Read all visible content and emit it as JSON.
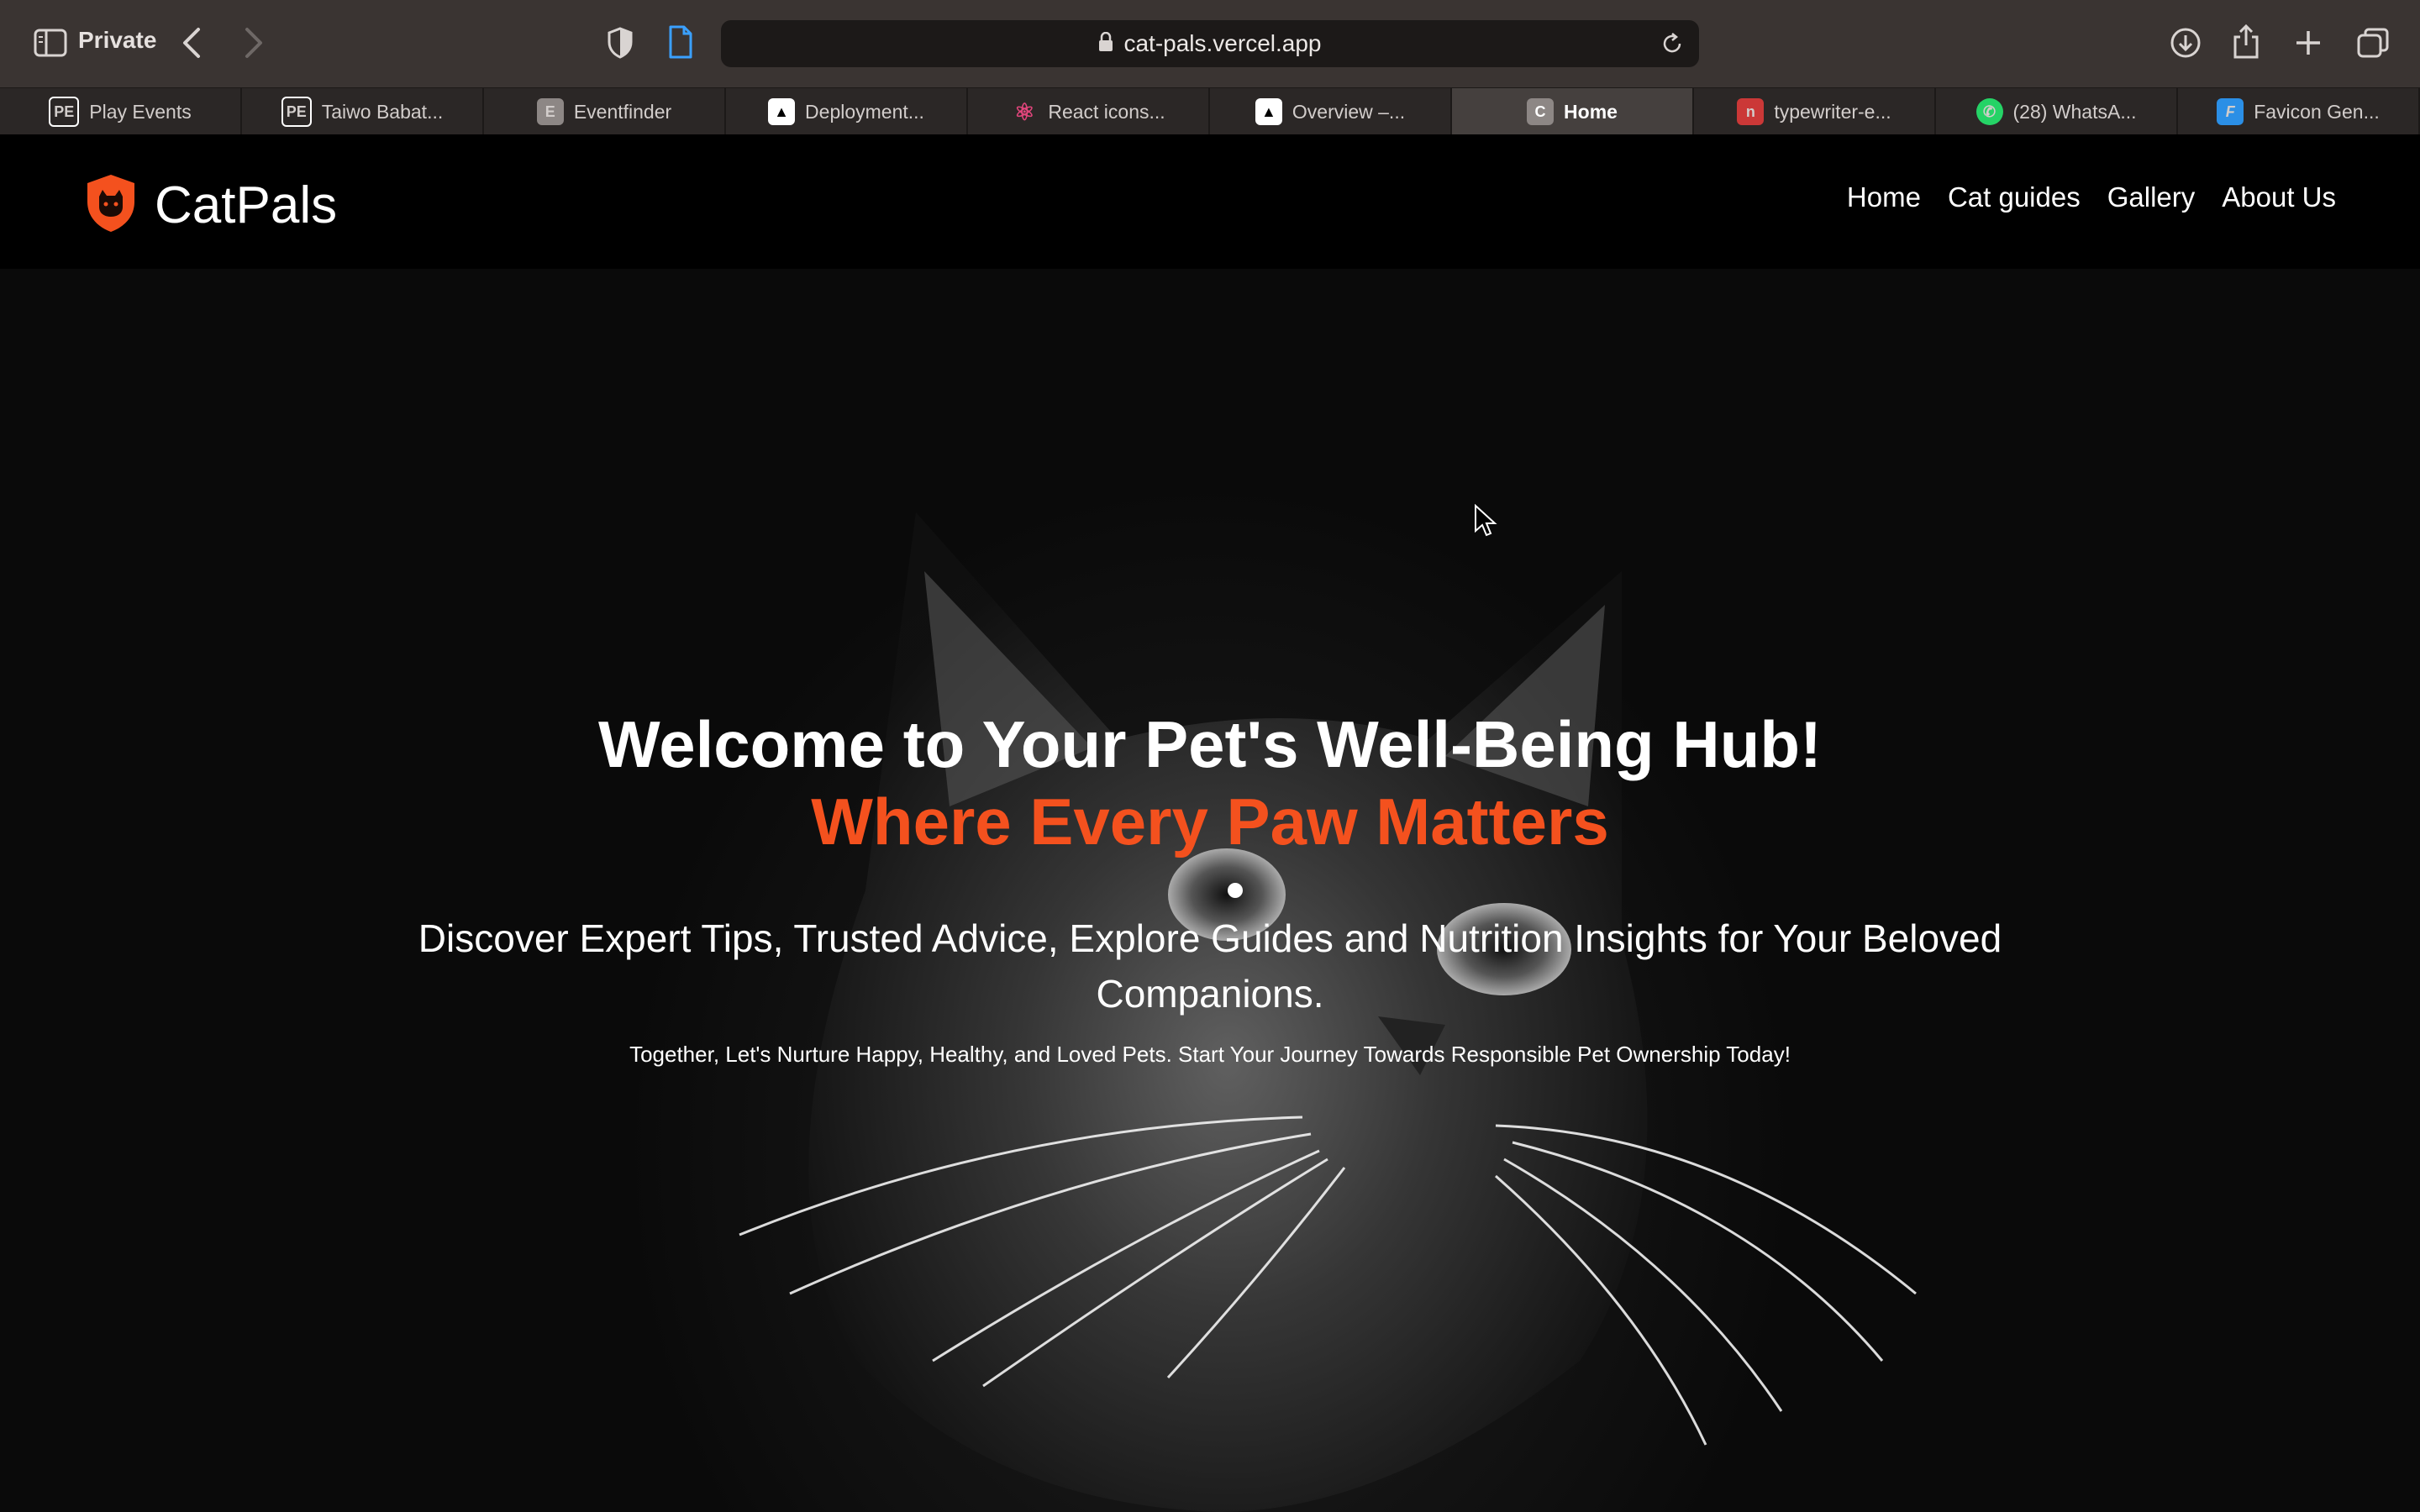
{
  "browser": {
    "private_label": "Private",
    "url": "cat-pals.vercel.app",
    "tabs": [
      {
        "label": "Play Events",
        "favicon": "PE",
        "color": "#ffffff",
        "bg": "#000000"
      },
      {
        "label": "Taiwo Babat...",
        "favicon": "PE",
        "color": "#ffffff",
        "bg": "#000000"
      },
      {
        "label": "Eventfinder",
        "favicon": "E",
        "color": "#ffffff",
        "bg": "#8d8785"
      },
      {
        "label": "Deployment...",
        "favicon": "▲",
        "color": "#000000",
        "bg": "#ffffff"
      },
      {
        "label": "React icons...",
        "favicon": "⚛",
        "color": "#e0457b",
        "bg": "#3a3432"
      },
      {
        "label": "Overview –...",
        "favicon": "▲",
        "color": "#000000",
        "bg": "#ffffff"
      },
      {
        "label": "Home",
        "favicon": "C",
        "color": "#ffffff",
        "bg": "#8d8785",
        "active": true
      },
      {
        "label": "typewriter-e...",
        "favicon": "n",
        "color": "#ffffff",
        "bg": "#cb3837"
      },
      {
        "label": "(28) WhatsA...",
        "favicon": "✆",
        "color": "#ffffff",
        "bg": "#25d366"
      },
      {
        "label": "Favicon Gen...",
        "favicon": "F",
        "color": "#ffffff",
        "bg": "#2b8fe6"
      }
    ]
  },
  "site": {
    "brand": "CatPals",
    "accent": "#f4511e",
    "nav": [
      "Home",
      "Cat guides",
      "Gallery",
      "About Us"
    ]
  },
  "hero": {
    "title": "Welcome to Your Pet's Well-Being Hub!",
    "subtitle": "Where Every Paw Matters",
    "description": "Discover Expert Tips, Trusted Advice, Explore Guides and Nutrition Insights for Your Beloved Companions.",
    "tagline": "Together, Let's Nurture Happy, Healthy, and Loved Pets. Start Your Journey Towards Responsible Pet Ownership Today!"
  }
}
